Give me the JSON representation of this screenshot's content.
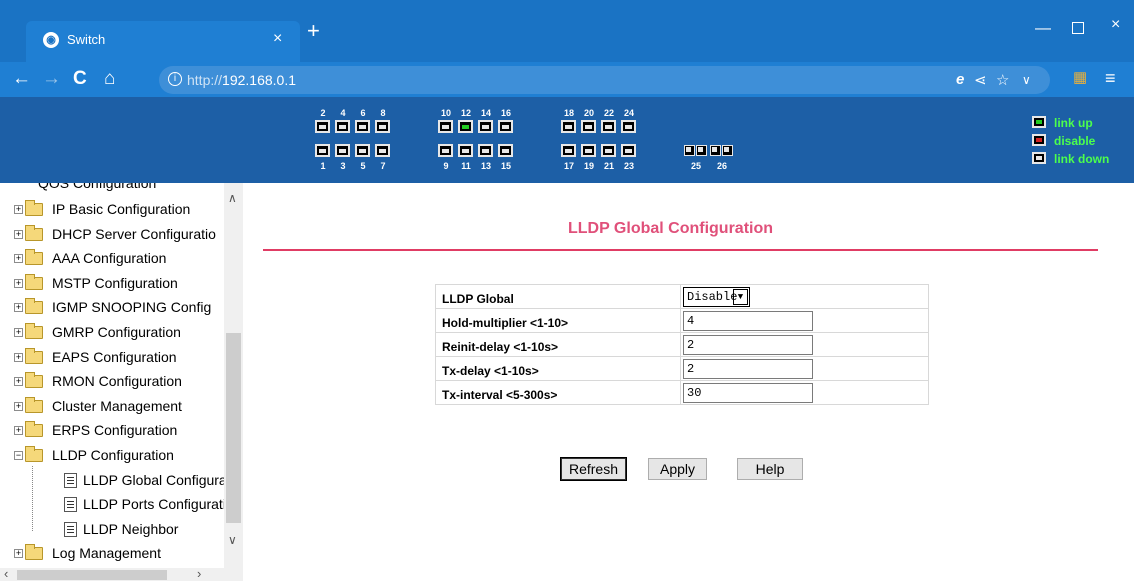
{
  "browser": {
    "tab_title": "Switch",
    "tab_close": "×",
    "new_tab": "+",
    "url_protocol": "http://",
    "url_host": "192.168.0.1",
    "back": "←",
    "forward": "→",
    "reload": "C",
    "home": "⌂",
    "window_min": "—",
    "window_close": "×"
  },
  "banner": {
    "top_numbers": [
      "2",
      "4",
      "6",
      "8",
      "10",
      "12",
      "14",
      "16",
      "18",
      "20",
      "22",
      "24"
    ],
    "bottom_numbers": [
      "1",
      "3",
      "5",
      "7",
      "9",
      "11",
      "13",
      "15",
      "17",
      "19",
      "21",
      "23"
    ],
    "fiber_numbers": [
      "25",
      "26"
    ],
    "up_ports": [
      "12"
    ],
    "legend": {
      "link_up": "link up",
      "disable": "disable",
      "link_down": "link down"
    }
  },
  "sidebar": {
    "cut_item": "QOS Configuration",
    "items": [
      "IP Basic Configuration",
      "DHCP Server Configuratio",
      "AAA Configuration",
      "MSTP Configuration",
      "IGMP SNOOPING Config",
      "GMRP Configuration",
      "EAPS Configuration",
      "RMON Configuration",
      "Cluster Management",
      "ERPS Configuration",
      "LLDP Configuration"
    ],
    "lldp_children": [
      "LLDP Global Configura",
      "LLDP Ports Configurati",
      "LLDP Neighbor"
    ],
    "last_item": "Log Management"
  },
  "main": {
    "title": "LLDP Global Configuration",
    "rows": [
      {
        "label": "LLDP Global",
        "value": "Disable"
      },
      {
        "label": "Hold-multiplier <1-10>",
        "value": "4"
      },
      {
        "label": "Reinit-delay <1-10s>",
        "value": "2"
      },
      {
        "label": "Tx-delay <1-10s>",
        "value": "2"
      },
      {
        "label": "Tx-interval <5-300s>",
        "value": "30"
      }
    ],
    "buttons": {
      "refresh": "Refresh",
      "apply": "Apply",
      "help": "Help"
    }
  },
  "colors": {
    "title": "#e0507a",
    "rule": "#e03c64",
    "banner": "#1d5fa6",
    "link_up": "#22cc22",
    "disable": "#d42222"
  }
}
